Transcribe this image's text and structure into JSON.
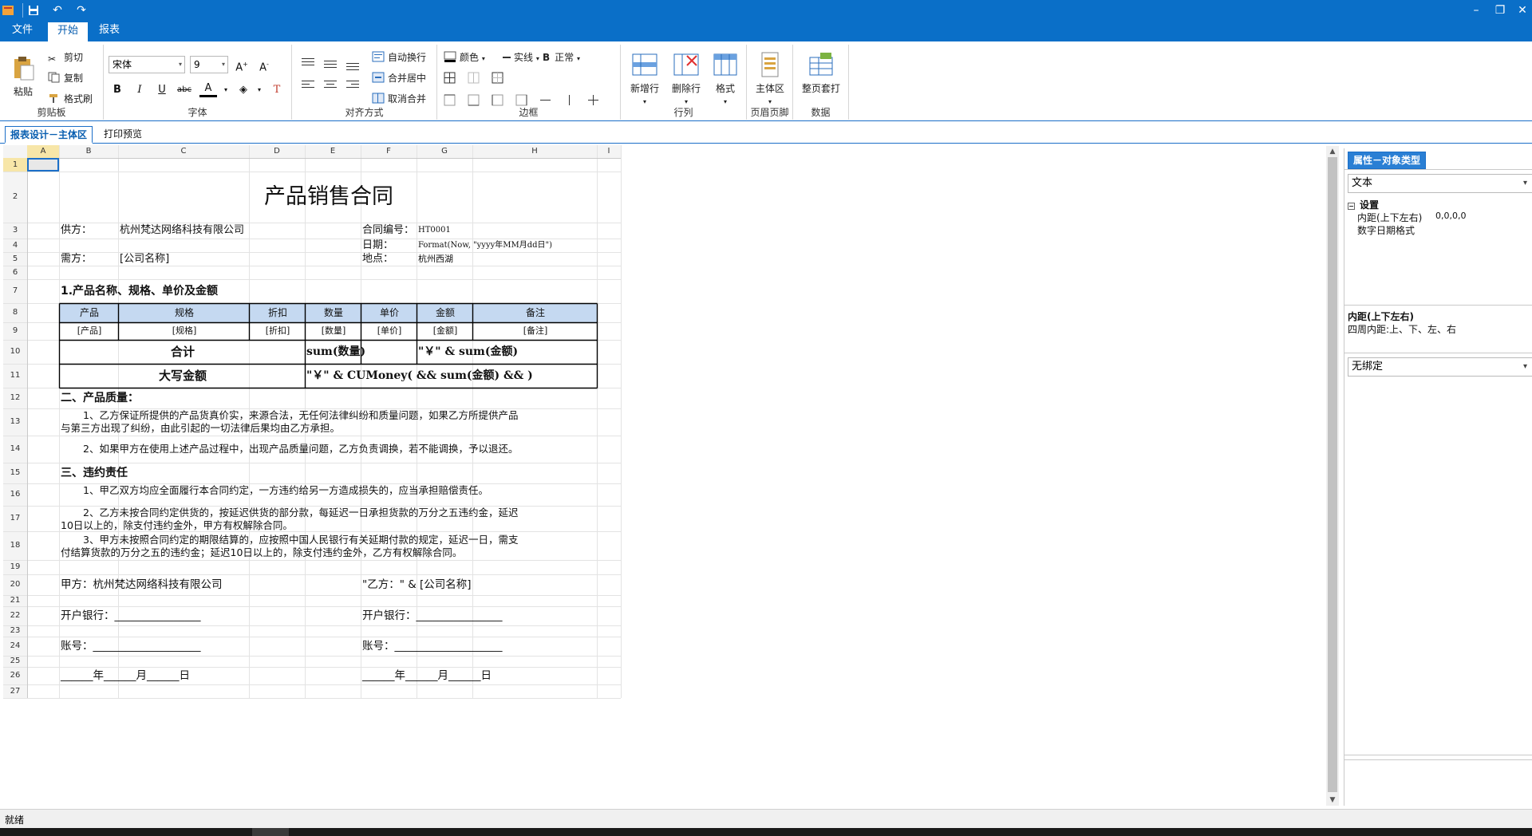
{
  "menu": {
    "tabs": [
      {
        "label": "文件"
      },
      {
        "label": "开始"
      },
      {
        "label": "报表"
      }
    ]
  },
  "ribbon": {
    "clipboard": {
      "group": "剪贴板",
      "paste": "粘贴",
      "cut": "剪切",
      "copy": "复制",
      "format_painter": "格式刷"
    },
    "font": {
      "group": "字体",
      "family": "宋体",
      "size": "9"
    },
    "align": {
      "group": "对齐方式",
      "wrap": "自动换行",
      "merge_center": "合并居中",
      "unmerge": "取消合并"
    },
    "border": {
      "group": "边框",
      "color": "颜色",
      "line": "实线",
      "weight_glyph": "B",
      "weight": "正常"
    },
    "rowcol": {
      "group": "行列",
      "add_row": "新增行",
      "delete_row": "删除行",
      "format": "格式"
    },
    "header_footer": {
      "group": "页眉页脚",
      "main_area": "主体区"
    },
    "data": {
      "group": "数据",
      "page_template": "整页套打"
    }
  },
  "doc_tabs": [
    {
      "label": "报表设计－主体区"
    },
    {
      "label": "打印预览"
    }
  ],
  "sheet": {
    "columns": [
      "A",
      "B",
      "C",
      "D",
      "E",
      "F",
      "G",
      "H",
      "I"
    ],
    "rows": [
      "1",
      "2",
      "3",
      "4",
      "5",
      "6",
      "7",
      "8",
      "9",
      "10",
      "11",
      "12",
      "13",
      "14",
      "15",
      "16",
      "17",
      "18",
      "19",
      "20",
      "21",
      "22",
      "23",
      "24",
      "25",
      "26",
      "27"
    ],
    "title": "产品销售合同",
    "supplier_label": "供方：",
    "supplier": "杭州梵达网络科技有限公司",
    "contract_no_label": "合同编号：",
    "contract_no": "HT0001",
    "date_label": "日期：",
    "date_expr": "Format(Now, \"yyyy年MM月dd日\")",
    "buyer_label": "需方：",
    "buyer": "[公司名称]",
    "place_label": "地点：",
    "place": "杭州西湖",
    "section1": "1.产品名称、规格、单价及金额",
    "table_headers": [
      "产品",
      "规格",
      "折扣",
      "数量",
      "单价",
      "金额",
      "备注"
    ],
    "table_row": [
      "[产品]",
      "[规格]",
      "[折扣]",
      "[数量]",
      "[单价]",
      "[金额]",
      "[备注]"
    ],
    "total_label": "合计",
    "total_qty": "sum(数量)",
    "total_amount": "\"￥\" & sum(金额)",
    "upper_label": "大写金额",
    "upper_expr": "\"￥\" & CUMoney( && sum(金额) && )",
    "section2": "二、产品质量：",
    "q1_line1": "1、乙方保证所提供的产品货真价实，来源合法，无任何法律纠纷和质量问题，如果乙方所提供产品",
    "q1_line2": "与第三方出现了纠纷，由此引起的一切法律后果均由乙方承担。",
    "q2": "2、如果甲方在使用上述产品过程中，出现产品质量问题，乙方负责调换，若不能调换，予以退还。",
    "section3": "三、违约责任",
    "b1": "1、甲乙双方均应全面履行本合同约定，一方违约给另一方造成损失的，应当承担赔偿责任。",
    "b2_line1": "2、乙方未按合同约定供货的，按延迟供货的部分款，每延迟一日承担货款的万分之五违约金，延迟",
    "b2_line2": "10日以上的，除支付违约金外，甲方有权解除合同。",
    "b3_line1": "3、甲方未按照合同约定的期限结算的，应按照中国人民银行有关延期付款的规定，延迟一日，需支",
    "b3_line2": "付结算货款的万分之五的违约金；延迟10日以上的，除支付违约金外，乙方有权解除合同。",
    "party_a": "甲方：杭州梵达网络科技有限公司",
    "party_b": "\"乙方：\" & [公司名称]",
    "bank_a": "开户银行：________________",
    "bank_b": "开户银行：________________",
    "acct_a": "账号：____________________",
    "acct_b": "账号：____________________",
    "date_sign_a": "______年______月______日",
    "date_sign_b": "______年______月______日"
  },
  "panel": {
    "tab": "属性－对象类型",
    "object_type": "文本",
    "section": "设置",
    "prop1_name": "内距(上下左右)",
    "prop1_value": "0,0,0,0",
    "prop2_name": "数字日期格式",
    "desc_title": "内距(上下左右)",
    "desc_text": "四周内距:上、下、左、右",
    "binding": "无绑定"
  },
  "status": {
    "text": "就绪"
  },
  "colors": {
    "accent": "#0a6fc8",
    "header_fill": "#c5d9f1",
    "selection_border": "#1b6fc8"
  }
}
